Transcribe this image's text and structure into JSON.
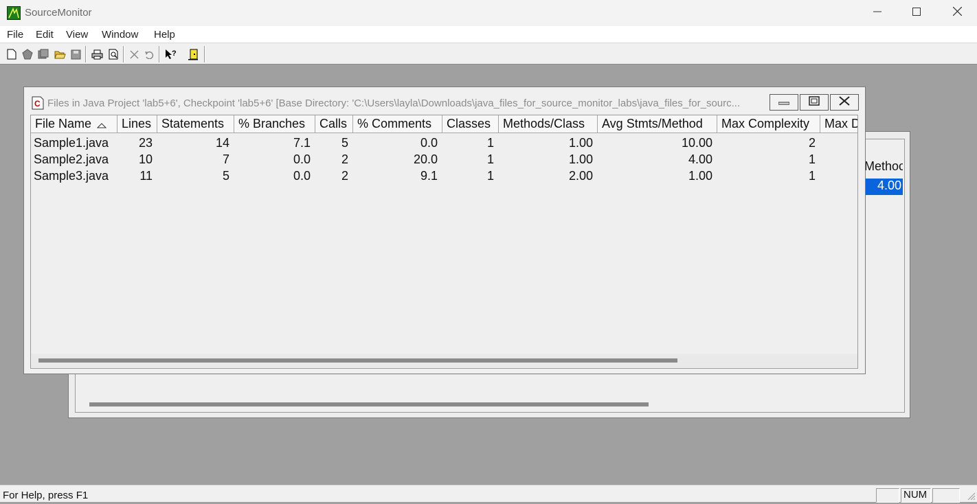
{
  "app": {
    "title": "SourceMonitor"
  },
  "menu": [
    "File",
    "Edit",
    "View",
    "Window",
    "Help"
  ],
  "toolbar": {
    "icons": [
      "new-file-icon",
      "open-project-icon",
      "checkpoint-icon",
      "open-folder-icon",
      "save-icon",
      "print-icon",
      "print-preview-icon",
      "delete-icon",
      "undo-icon",
      "help-pointer-icon",
      "exit-icon"
    ]
  },
  "back_window": {
    "visible_header": "Methoc",
    "visible_selected_value": "4.00"
  },
  "front_window": {
    "title": "Files in Java Project 'lab5+6', Checkpoint 'lab5+6'  [Base Directory: 'C:\\Users\\layla\\Downloads\\java_files_for_source_monitor_labs\\java_files_for_sourc...",
    "columns": [
      "File Name",
      "Lines",
      "Statements",
      "% Branches",
      "Calls",
      "% Comments",
      "Classes",
      "Methods/Class",
      "Avg Stmts/Method",
      "Max Complexity",
      "Max D"
    ],
    "sort_column": "File Name",
    "rows": [
      [
        "Sample1.java",
        "23",
        "14",
        "7.1",
        "5",
        "0.0",
        "1",
        "1.00",
        "10.00",
        "2"
      ],
      [
        "Sample2.java",
        "10",
        "7",
        "0.0",
        "2",
        "20.0",
        "1",
        "1.00",
        "4.00",
        "1"
      ],
      [
        "Sample3.java",
        "11",
        "5",
        "0.0",
        "2",
        "9.1",
        "1",
        "2.00",
        "1.00",
        "1"
      ]
    ]
  },
  "status": {
    "help_text": "For Help, press F1",
    "panels": [
      "",
      "NUM",
      ""
    ]
  },
  "colors": {
    "selection": "#0a64dc",
    "workspace": "#a0a0a0",
    "app_icon": "#1e7e1e"
  }
}
